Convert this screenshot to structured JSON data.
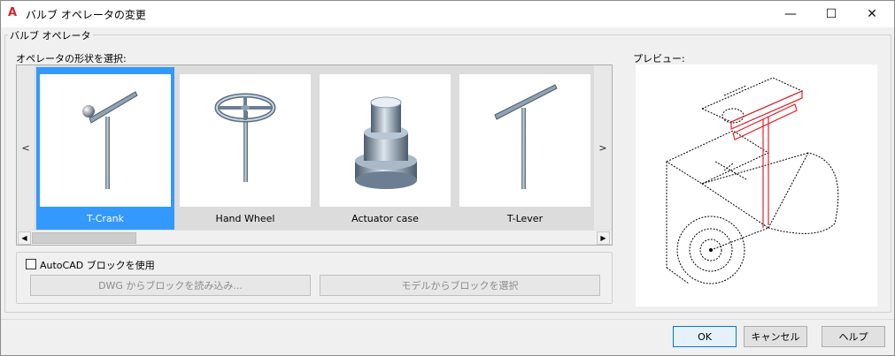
{
  "window": {
    "title": "バルブ オペレータの変更",
    "app_icon_letter": "A",
    "controls": {
      "minimize": "—",
      "maximize": "☐",
      "close": "✕"
    }
  },
  "group": {
    "legend": "バルブ オペレータ",
    "select_label": "オペレータの形状を選択:",
    "preview_label": "プレビュー:"
  },
  "gallery": {
    "prev_arrow": "<",
    "next_arrow": ">",
    "selected_index": 0,
    "items": [
      {
        "label": "T-Crank",
        "icon": "t-crank-icon"
      },
      {
        "label": "Hand Wheel",
        "icon": "hand-wheel-icon"
      },
      {
        "label": "Actuator case",
        "icon": "actuator-case-icon"
      },
      {
        "label": "T-Lever",
        "icon": "t-lever-icon"
      }
    ],
    "scroll_left": "◀",
    "scroll_right": "▶"
  },
  "block": {
    "checkbox_label": "AutoCAD ブロックを使用",
    "checked": false,
    "load_from_dwg": "DWG からブロックを読み込み...",
    "select_from_model": "モデルからブロックを選択"
  },
  "footer": {
    "ok": "OK",
    "cancel": "キャンセル",
    "help": "ヘルプ"
  },
  "colors": {
    "selection": "#3399ff",
    "preview_highlight": "#e8202a"
  }
}
